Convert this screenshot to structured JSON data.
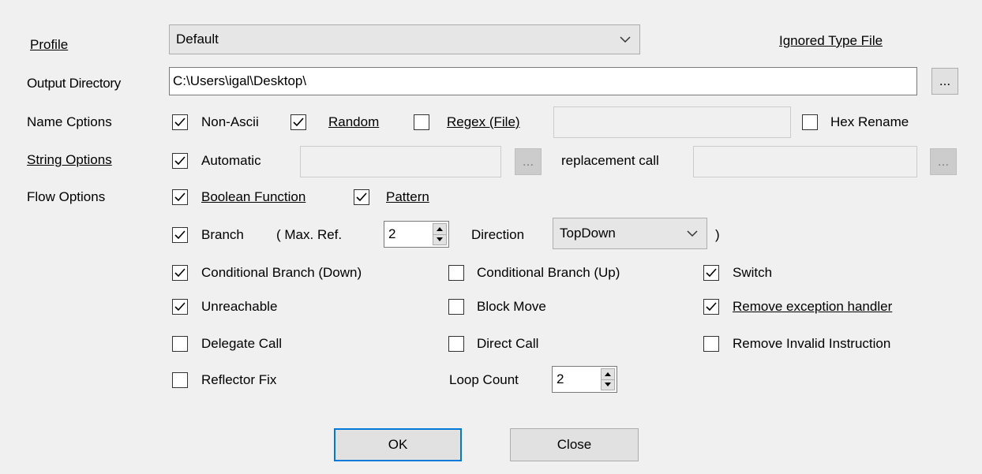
{
  "labels": {
    "profile": "Profile",
    "output_directory": "Output Directory",
    "name_options": "Name Cptions",
    "string_options": "String Options",
    "flow_options": "Flow Options"
  },
  "profile": {
    "selected": "Default"
  },
  "ignored_type_file": "Ignored Type File",
  "output_directory": {
    "value": "C:\\Users\\igal\\Desktop\\",
    "browse_label": "..."
  },
  "name_options": {
    "non_ascii": {
      "label": "Non-Ascii",
      "checked": true
    },
    "random": {
      "label": "Random",
      "checked": true
    },
    "regex_file": {
      "label": "Regex (File)",
      "checked": false,
      "value": ""
    },
    "hex_rename": {
      "label": "Hex Rename",
      "checked": false
    }
  },
  "string_options": {
    "automatic": {
      "label": "Automatic",
      "checked": true,
      "value": ""
    },
    "browse_label": "...",
    "replacement_call_label": "replacement call",
    "replacement_call_value": "",
    "replacement_browse_label": "..."
  },
  "flow_options": {
    "boolean_function": {
      "label": "Boolean Function",
      "checked": true
    },
    "pattern": {
      "label": "Pattern",
      "checked": true
    },
    "branch": {
      "label": "Branch",
      "checked": true
    },
    "max_ref_label": "( Max. Ref.",
    "max_ref_value": "2",
    "direction_label": "Direction",
    "direction_value": "TopDown",
    "close_paren": ")",
    "conditional_branch_down": {
      "label": "Conditional Branch (Down)",
      "checked": true
    },
    "conditional_branch_up": {
      "label": "Conditional Branch (Up)",
      "checked": false
    },
    "switch": {
      "label": "Switch",
      "checked": true
    },
    "unreachable": {
      "label": "Unreachable",
      "checked": true
    },
    "block_move": {
      "label": "Block Move",
      "checked": false
    },
    "remove_exception_handler": {
      "label": "Remove exception handler",
      "checked": true
    },
    "delegate_call": {
      "label": "Delegate Call",
      "checked": false
    },
    "direct_call": {
      "label": "Direct Call",
      "checked": false
    },
    "remove_invalid_instruction": {
      "label": "Remove Invalid Instruction",
      "checked": false
    },
    "reflector_fix": {
      "label": "Reflector Fix",
      "checked": false
    },
    "loop_count_label": "Loop Count",
    "loop_count_value": "2"
  },
  "buttons": {
    "ok": "OK",
    "close": "Close"
  },
  "icons": {
    "dropdown": "chevron-down-icon",
    "check": "check-icon",
    "spin": "spin-arrows-icon"
  },
  "colors": {
    "background": "#f0f0f0",
    "focus_border": "#0078d7"
  }
}
